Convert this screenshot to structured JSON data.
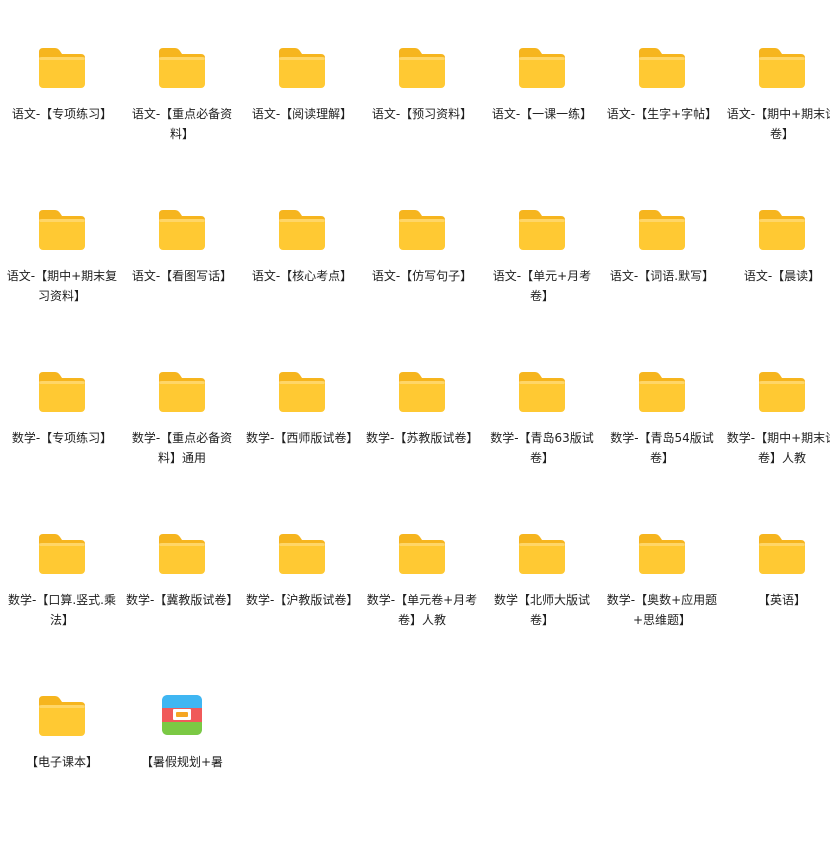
{
  "items": [
    {
      "label": "语文-【专项练习】",
      "icon": "folder-icon"
    },
    {
      "label": "语文-【重点必备资料】",
      "icon": "folder-icon"
    },
    {
      "label": "语文-【阅读理解】",
      "icon": "folder-icon"
    },
    {
      "label": "语文-【预习资料】",
      "icon": "folder-icon"
    },
    {
      "label": "语文-【一课一练】",
      "icon": "folder-icon"
    },
    {
      "label": "语文-【生字+字帖】",
      "icon": "folder-icon"
    },
    {
      "label": "语文-【期中+期末试卷】",
      "icon": "folder-icon"
    },
    {
      "label": "语文-【期中+期末复习资料】",
      "icon": "folder-icon"
    },
    {
      "label": "语文-【看图写话】",
      "icon": "folder-icon"
    },
    {
      "label": "语文-【核心考点】",
      "icon": "folder-icon"
    },
    {
      "label": "语文-【仿写句子】",
      "icon": "folder-icon"
    },
    {
      "label": "语文-【单元+月考卷】",
      "icon": "folder-icon"
    },
    {
      "label": "语文-【词语.默写】",
      "icon": "folder-icon"
    },
    {
      "label": "语文-【晨读】",
      "icon": "folder-icon"
    },
    {
      "label": "数学-【专项练习】",
      "icon": "folder-icon"
    },
    {
      "label": "数学-【重点必备资料】通用",
      "icon": "folder-icon"
    },
    {
      "label": "数学-【西师版试卷】",
      "icon": "folder-icon"
    },
    {
      "label": "数学-【苏教版试卷】",
      "icon": "folder-icon"
    },
    {
      "label": "数学-【青岛63版试卷】",
      "icon": "folder-icon"
    },
    {
      "label": "数学-【青岛54版试卷】",
      "icon": "folder-icon"
    },
    {
      "label": "数学-【期中+期末试卷】人教",
      "icon": "folder-icon"
    },
    {
      "label": "数学-【口算.竖式.乘法】",
      "icon": "folder-icon"
    },
    {
      "label": "数学-【冀教版试卷】",
      "icon": "folder-icon"
    },
    {
      "label": "数学-【沪教版试卷】",
      "icon": "folder-icon"
    },
    {
      "label": "数学-【单元卷+月考卷】人教",
      "icon": "folder-icon"
    },
    {
      "label": "数学【北师大版试卷】",
      "icon": "folder-icon"
    },
    {
      "label": "数学-【奥数+应用题+思维题】",
      "icon": "folder-icon"
    },
    {
      "label": "【英语】",
      "icon": "folder-icon"
    },
    {
      "label": "【电子课本】",
      "icon": "folder-icon"
    },
    {
      "label": "【暑假规划+暑",
      "icon": "archive-icon"
    }
  ]
}
